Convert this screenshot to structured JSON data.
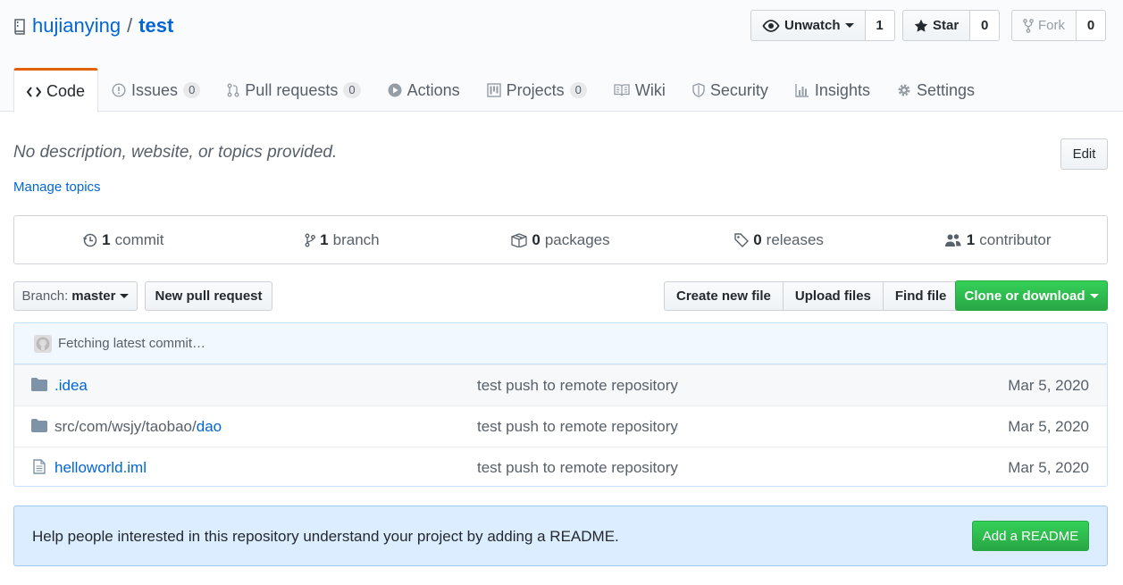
{
  "repo": {
    "owner": "hujianying",
    "separator": "/",
    "name": "test"
  },
  "social": {
    "watch": {
      "label": "Unwatch",
      "count": "1"
    },
    "star": {
      "label": "Star",
      "count": "0"
    },
    "fork": {
      "label": "Fork",
      "count": "0"
    }
  },
  "tabs": [
    {
      "label": "Code",
      "icon": "code-icon",
      "selected": true
    },
    {
      "label": "Issues",
      "icon": "issue-icon",
      "count": "0"
    },
    {
      "label": "Pull requests",
      "icon": "pull-request-icon",
      "count": "0"
    },
    {
      "label": "Actions",
      "icon": "play-icon"
    },
    {
      "label": "Projects",
      "icon": "project-icon",
      "count": "0"
    },
    {
      "label": "Wiki",
      "icon": "book-icon"
    },
    {
      "label": "Security",
      "icon": "shield-icon"
    },
    {
      "label": "Insights",
      "icon": "graph-icon"
    },
    {
      "label": "Settings",
      "icon": "gear-icon"
    }
  ],
  "description": {
    "text": "No description, website, or topics provided.",
    "manage_topics": "Manage topics",
    "edit_label": "Edit"
  },
  "summary": {
    "commits": {
      "count": "1",
      "label": "commit"
    },
    "branches": {
      "count": "1",
      "label": "branch"
    },
    "packages": {
      "count": "0",
      "label": "packages"
    },
    "releases": {
      "count": "0",
      "label": "releases"
    },
    "contributors": {
      "count": "1",
      "label": "contributor"
    }
  },
  "file_nav": {
    "branch_label": "Branch:",
    "branch_value": "master",
    "new_pull_request": "New pull request",
    "create_new_file": "Create new file",
    "upload_files": "Upload files",
    "find_file": "Find file",
    "clone_or_download": "Clone or download"
  },
  "commit_tease": "Fetching latest commit…",
  "files": [
    {
      "type": "folder",
      "prefix": "",
      "name": ".idea",
      "message": "test push to remote repository",
      "age": "Mar 5, 2020"
    },
    {
      "type": "folder",
      "prefix": "src/com/wsjy/taobao/",
      "name": "dao",
      "message": "test push to remote repository",
      "age": "Mar 5, 2020"
    },
    {
      "type": "file",
      "prefix": "",
      "name": "helloworld.iml",
      "message": "test push to remote repository",
      "age": "Mar 5, 2020"
    }
  ],
  "readme_prompt": {
    "text": "Help people interested in this repository understand your project by adding a README.",
    "button": "Add a README"
  },
  "colors": {
    "link": "#0366d6",
    "accent_tab": "#e36209",
    "primary_green": "#28a745",
    "readme_bg": "#dbedff"
  }
}
